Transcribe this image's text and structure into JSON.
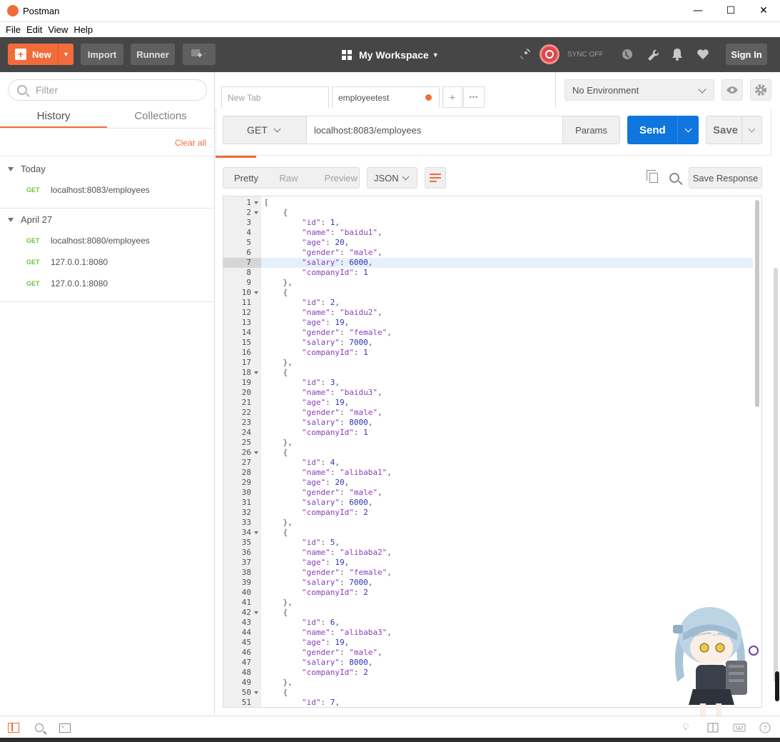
{
  "window": {
    "title": "Postman",
    "minimize": "—",
    "maximize": "☐",
    "close": "✕"
  },
  "menu": [
    "File",
    "Edit",
    "View",
    "Help"
  ],
  "toolbar": {
    "new_label": "New",
    "import_label": "Import",
    "runner_label": "Runner",
    "workspace_label": "My Workspace",
    "sync_label": "SYNC OFF",
    "signin_label": "Sign In"
  },
  "sidebar": {
    "filter_placeholder": "Filter",
    "tabs": [
      "History",
      "Collections"
    ],
    "active_tab": "History",
    "clear_all": "Clear all",
    "groups": [
      {
        "label": "Today",
        "items": [
          {
            "method": "GET",
            "url": "localhost:8083/employees"
          }
        ]
      },
      {
        "label": "April 27",
        "items": [
          {
            "method": "GET",
            "url": "localhost:8080/employees"
          },
          {
            "method": "GET",
            "url": "127.0.0.1:8080"
          },
          {
            "method": "GET",
            "url": "127.0.0.1:8080"
          }
        ]
      }
    ]
  },
  "tabs": [
    {
      "label": "New Tab",
      "active": false
    },
    {
      "label": "employeetest",
      "active": true,
      "unsaved": true
    }
  ],
  "tab_actions": {
    "add": "+",
    "more": "•••"
  },
  "environment": {
    "selected": "No Environment"
  },
  "request": {
    "method": "GET",
    "url": "localhost:8083/employees",
    "params_label": "Params",
    "send_label": "Send",
    "save_label": "Save"
  },
  "response": {
    "views": [
      "Pretty",
      "Raw",
      "Preview"
    ],
    "active_view": "Pretty",
    "format": "JSON",
    "save_response_label": "Save Response",
    "highlighted_line": 7,
    "lines": [
      "[",
      "    {",
      "        \"id\": 1,",
      "        \"name\": \"baidu1\",",
      "        \"age\": 20,",
      "        \"gender\": \"male\",",
      "        \"salary\": 6000,",
      "        \"companyId\": 1",
      "    },",
      "    {",
      "        \"id\": 2,",
      "        \"name\": \"baidu2\",",
      "        \"age\": 19,",
      "        \"gender\": \"female\",",
      "        \"salary\": 7000,",
      "        \"companyId\": 1",
      "    },",
      "    {",
      "        \"id\": 3,",
      "        \"name\": \"baidu3\",",
      "        \"age\": 19,",
      "        \"gender\": \"male\",",
      "        \"salary\": 8000,",
      "        \"companyId\": 1",
      "    },",
      "    {",
      "        \"id\": 4,",
      "        \"name\": \"alibaba1\",",
      "        \"age\": 20,",
      "        \"gender\": \"male\",",
      "        \"salary\": 6000,",
      "        \"companyId\": 2",
      "    },",
      "    {",
      "        \"id\": 5,",
      "        \"name\": \"alibaba2\",",
      "        \"age\": 19,",
      "        \"gender\": \"female\",",
      "        \"salary\": 7000,",
      "        \"companyId\": 2",
      "    },",
      "    {",
      "        \"id\": 6,",
      "        \"name\": \"alibaba3\",",
      "        \"age\": 19,",
      "        \"gender\": \"male\",",
      "        \"salary\": 8000,",
      "        \"companyId\": 2",
      "    },",
      "    {",
      "        \"id\": 7,"
    ],
    "fold_lines": [
      1,
      2,
      10,
      18,
      26,
      34,
      42,
      50
    ]
  },
  "colors": {
    "accent": "#f26b3a",
    "send": "#0f76de",
    "get": "#6ec23c",
    "toolbar": "#464646"
  },
  "icons": [
    "satellite-icon",
    "wrench-icon",
    "globe-icon",
    "bell-icon",
    "heart-icon",
    "eye-icon",
    "gear-icon",
    "copy-icon",
    "search-icon",
    "sidebar-toggle-icon",
    "console-icon",
    "bulb-icon",
    "layout-icon",
    "keyboard-icon",
    "help-icon"
  ]
}
